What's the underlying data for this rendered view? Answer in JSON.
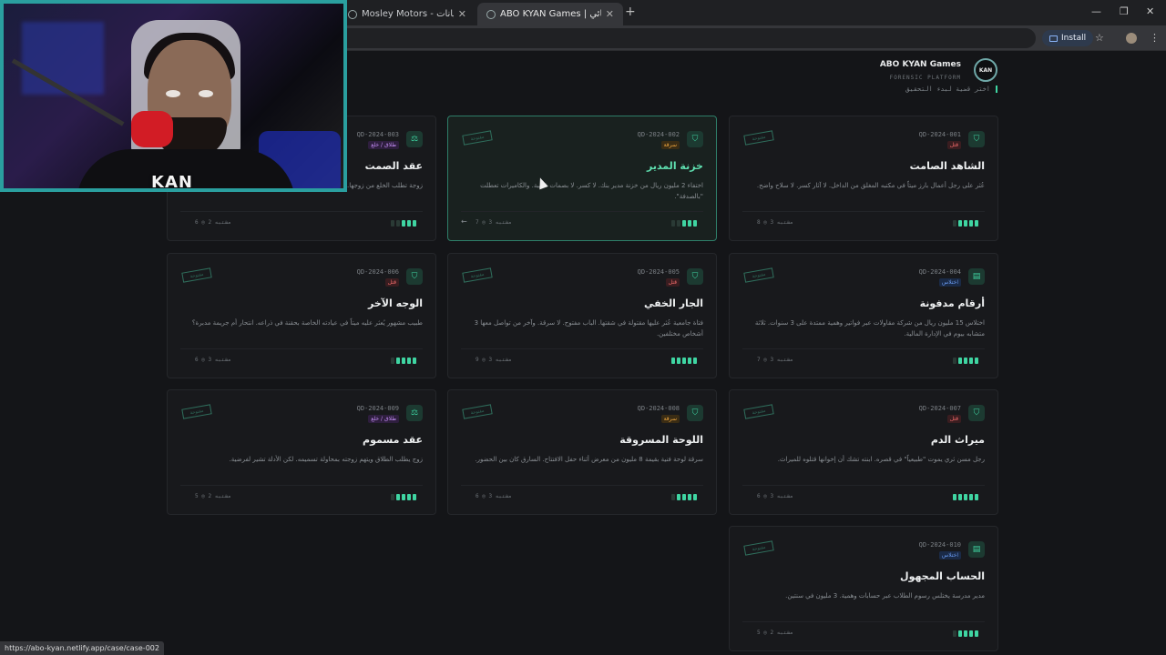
{
  "browser": {
    "tabs": [
      {
        "title": "Mosley Motors - جداول بيانات G"
      },
      {
        "title": "ABO KYAN Games | محقق الجنائي"
      }
    ],
    "install_label": "Install"
  },
  "header": {
    "brand": "ABO KYAN Games",
    "sub": "FORENSIC PLATFORM",
    "logo": "KAN",
    "subtitle": "اختر قضية لبدء التحقيق"
  },
  "cards": [
    {
      "code": "QD-2024-001",
      "tag": "قتل",
      "title": "الشاهد الصامت",
      "desc": "عُثر على رجل أعمال بارز ميتاً في مكتبه المغلق من الداخل. لا آثار كسر. لا سلاح واضح.",
      "meta": "8 ◎ 3 مشتبه",
      "stamp": "مفتوحة",
      "dots": 4
    },
    {
      "code": "QD-2024-002",
      "tag": "سرقة",
      "title": "خزنة المدير",
      "desc": "اختفاء 2 مليون ريال من خزنة مدير بنك. لا كسر. لا بصمات غريبة. والكاميرات تعطلت \"بالصدفة\".",
      "meta": "7 ◎ 3 مشتبه",
      "stamp": "مفتوحة",
      "dots": 3
    },
    {
      "code": "QD-2024-003",
      "tag": "طلاق / خلع",
      "title": "عقد الصمت",
      "desc": "زوجة تطلب الخلع من زوجها... أمواله. من يقول الحقيقة؟",
      "meta": "6 ◎ 2 مشتبه",
      "stamp": "مفتوحة",
      "dots": 3
    },
    {
      "code": "QD-2024-004",
      "tag": "اختلاس",
      "title": "أرقام مدفونة",
      "desc": "اختلاس 15 مليون ريال من شركة مقاولات عبر فواتير وهمية ممتدة على 3 سنوات. ثلاثة متشابه بيوم في الإدارة المالية.",
      "meta": "7 ◎ 3 مشتبه",
      "stamp": "مفتوحة",
      "dots": 4
    },
    {
      "code": "QD-2024-005",
      "tag": "قتل",
      "title": "الجار الخفي",
      "desc": "فتاة جامعية عُثر عليها مقتولة في شقتها. الباب مفتوح. لا سرقة. وآخر من تواصل معها 3 أشخاص مختلفين.",
      "meta": "9 ◎ 3 مشتبه",
      "stamp": "مفتوحة",
      "dots": 5
    },
    {
      "code": "QD-2024-006",
      "tag": "قتل",
      "title": "الوجه الآخر",
      "desc": "طبيب مشهور يُعثر عليه ميتاً في عيادته الخاصة بحقنة في ذراعه. انتحار أم جريمة مدبرة؟",
      "meta": "6 ◎ 3 مشتبه",
      "stamp": "مفتوحة",
      "dots": 4
    },
    {
      "code": "QD-2024-007",
      "tag": "قتل",
      "title": "ميراث الدم",
      "desc": "رجل مسن ثري يموت \"طبيعياً\" في قصره. ابنته تشك أن إخوانها قتلوه للميراث.",
      "meta": "6 ◎ 3 مشتبه",
      "stamp": "مفتوحة",
      "dots": 5
    },
    {
      "code": "QD-2024-008",
      "tag": "سرقة",
      "title": "اللوحة المسروقة",
      "desc": "سرقة لوحة فنية بقيمة 8 مليون من معرض أثناء حفل الافتتاح. السارق كان بين الحضور.",
      "meta": "6 ◎ 3 مشتبه",
      "stamp": "مفتوحة",
      "dots": 4
    },
    {
      "code": "QD-2024-009",
      "tag": "طلاق / خلع",
      "title": "عقد مسموم",
      "desc": "زوج يطلب الطلاق ويتهم زوجته بمحاولة تسميمه. لكن الأدلة تشير لفرضية.",
      "meta": "5 ◎ 2 مشتبه",
      "stamp": "مفتوحة",
      "dots": 4
    },
    {
      "code": "QD-2024-010",
      "tag": "اختلاس",
      "title": "الحساب المجهول",
      "desc": "مدير مدرسة يختلس رسوم الطلاب عبر حسابات وهمية. 3 مليون في سنتين.",
      "meta": "5 ◎ 2 مشتبه",
      "stamp": "مفتوحة",
      "dots": 4
    }
  ],
  "status_url": "https://abo-kyan.netlify.app/case/case-002",
  "cam_logo": "KAN"
}
